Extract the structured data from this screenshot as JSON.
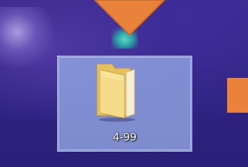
{
  "desktop": {
    "selected_item": {
      "label": "4-99",
      "icon": "folder-icon"
    },
    "icons": {
      "teal_app": "app-icon",
      "pointer": "arrow-down-icon",
      "marker": "orange-marker"
    },
    "colors": {
      "background": "#3a2a8a",
      "selection": "#96aae6",
      "arrow": "#e9823b",
      "folder": "#f2d27a"
    }
  }
}
